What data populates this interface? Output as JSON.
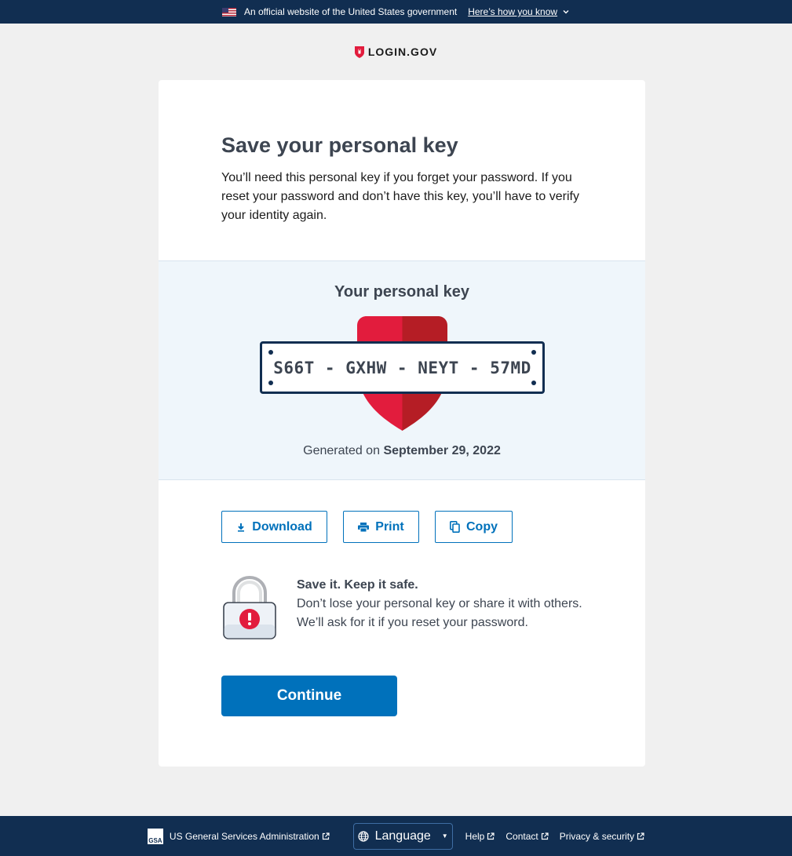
{
  "banner": {
    "text": "An official website of the United States government",
    "link": "Here’s how you know"
  },
  "logo": {
    "text": "LOGIN.GOV"
  },
  "page": {
    "title": "Save your personal key",
    "intro": "You’ll need this personal key if you forget your password. If you reset your password and don’t have this key, you’ll have to verify your identity again."
  },
  "key": {
    "title": "Your personal key",
    "code": "S66T - GXHW - NEYT - 57MD",
    "generated_prefix": "Generated on",
    "generated_date": "September 29, 2022"
  },
  "actions": {
    "download": "Download",
    "print": "Print",
    "copy": "Copy"
  },
  "warning": {
    "title": "Save it. Keep it safe.",
    "body": "Don’t lose your personal key or share it with others. We’ll ask for it if you reset your password."
  },
  "continue_label": "Continue",
  "footer": {
    "gsa_badge": "GSA",
    "gsa": "US General Services Administration",
    "language": "Language",
    "help": "Help",
    "contact": "Contact",
    "privacy": "Privacy & security"
  },
  "colors": {
    "primary": "#0071bb",
    "navy": "#112e51",
    "red": "#e21c3d",
    "key_bg": "#eff6fb"
  }
}
